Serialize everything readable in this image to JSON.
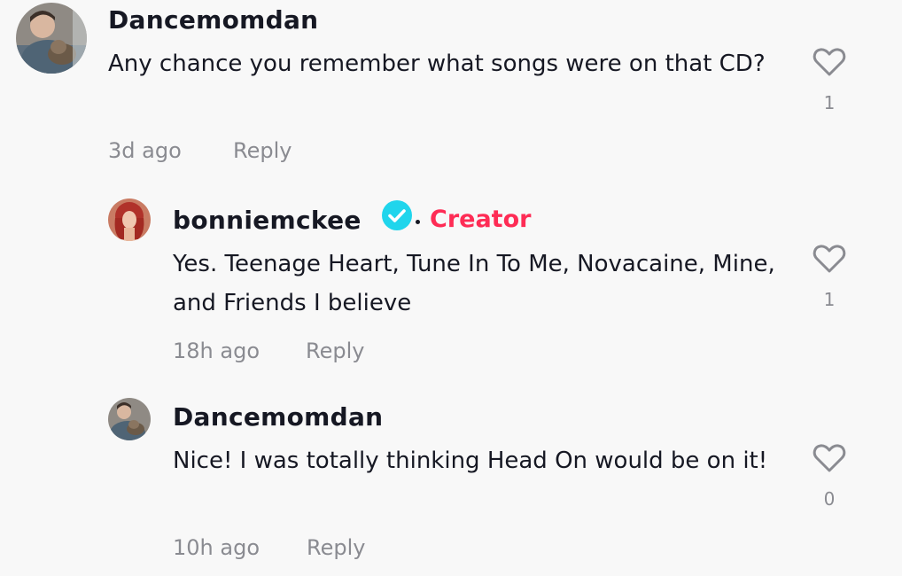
{
  "comments": [
    {
      "username": "Dancemomdan",
      "text": "Any chance you remember what songs were on that CD?",
      "time": "3d ago",
      "reply_label": "Reply",
      "likes": "1",
      "avatar_icon": "user-photo-man-with-cat"
    },
    {
      "username": "bonniemckee",
      "badge": "Creator",
      "verified": true,
      "text": "Yes. Teenage Heart, Tune In To Me, Novacaine, Mine, and Friends I believe",
      "time": "18h ago",
      "reply_label": "Reply",
      "likes": "1",
      "avatar_icon": "user-photo-red-hair-woman"
    },
    {
      "username": "Dancemomdan",
      "text": "Nice! I was totally thinking Head On would be on it!",
      "time": "10h ago",
      "reply_label": "Reply",
      "likes": "0",
      "avatar_icon": "user-photo-man-with-cat"
    }
  ],
  "colors": {
    "background": "#f8f8f8",
    "primary_text": "#161823",
    "secondary_text": "#8a8b91",
    "creator_badge": "#fe2c55",
    "verified_badge": "#20d5ec"
  }
}
